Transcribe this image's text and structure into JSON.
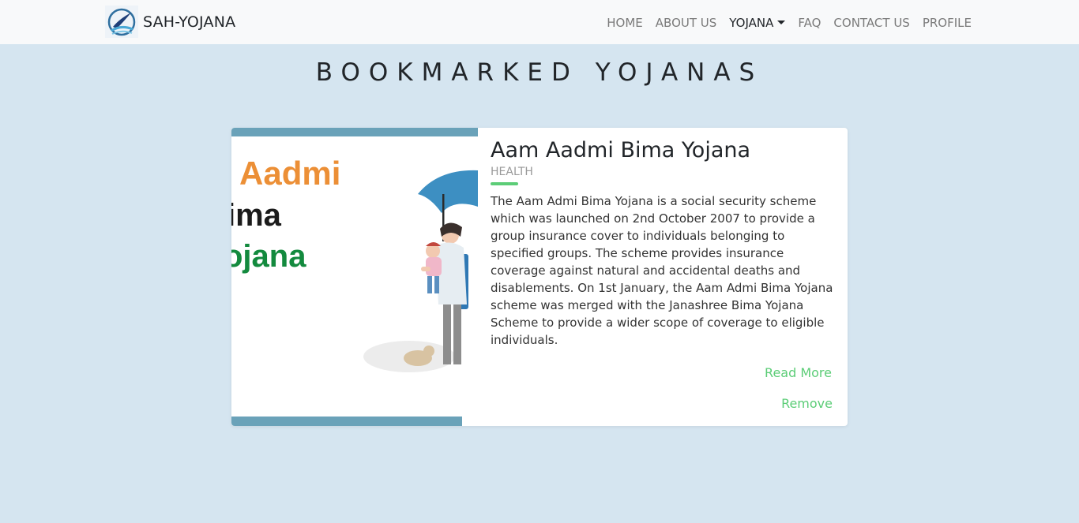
{
  "brand": {
    "name": "SAH-YOJANA",
    "logo_icon": "quill-pen-logo-icon"
  },
  "nav": {
    "items": [
      {
        "label": "HOME",
        "active": false
      },
      {
        "label": "ABOUT US",
        "active": false
      },
      {
        "label": "YOJANA",
        "active": true,
        "dropdown": true
      },
      {
        "label": "FAQ",
        "active": false
      },
      {
        "label": "CONTACT US",
        "active": false
      },
      {
        "label": "PROFILE",
        "active": false
      }
    ]
  },
  "page": {
    "title": "BOOKMARKED YOJANAS"
  },
  "bookmarks": [
    {
      "title": "Aam Aadmi Bima Yojana",
      "category": "HEALTH",
      "image_text": [
        "Aadmi",
        "ima",
        "ojana"
      ],
      "description": "The Aam Admi Bima Yojana is a social security scheme which was launched on 2nd October 2007 to provide a group insurance cover to individuals belonging to specified groups. The scheme provides insurance coverage against natural and accidental deaths and disablements. On 1st January, the Aam Admi Bima Yojana scheme was merged with the Janashree Bima Yojana Scheme to provide a wider scope of coverage to eligible individuals.",
      "read_more_label": "Read More",
      "remove_label": "Remove"
    }
  ],
  "colors": {
    "background": "#d5e5f0",
    "navbar": "#f8f9fa",
    "accent": "#5ccd77",
    "image_border": "#6aa2b9"
  }
}
